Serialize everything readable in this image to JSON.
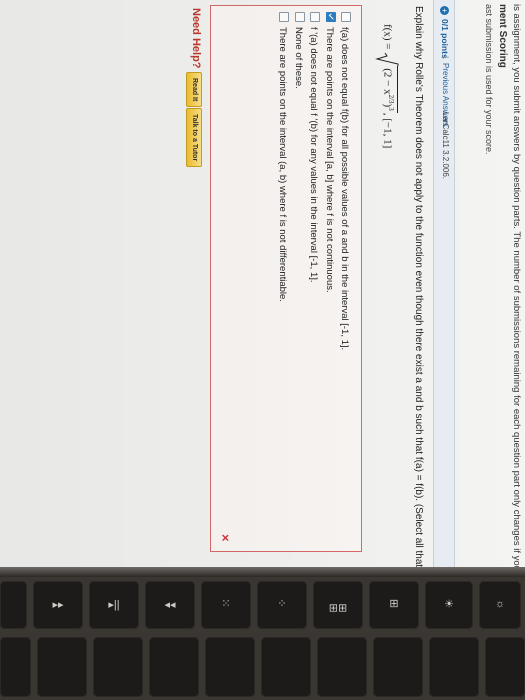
{
  "notice": "is assignment, you submit answers by question parts. The number of submissions remaining for each question part only changes if you submit or change the a",
  "heading": "ment Scoring",
  "last_submission": "ast submission is used for your score.",
  "question": {
    "number": "4.",
    "points_label": "0/1 points",
    "separator": "|",
    "previous_answers": "Previous Answers",
    "reference": "LarCalc11 3.2.006.",
    "prompt": "Explain why Rolle's Theorem does not apply to the function even though there exist a and b such that f(a) = f(b). (Select all that apply.)",
    "formula": {
      "lhs": "f(x) =",
      "inner": "(2 − x",
      "inner_exp": "2/3",
      "close": ")",
      "outer_exp": "3",
      "interval": ",  [−1, 1]"
    },
    "options": [
      {
        "text": "f(a) does not equal f(b) for all possible values of a and b in the interval [-1, 1].",
        "checked": false
      },
      {
        "text": "There are points on the interval [a, b] where f is not continuous.",
        "checked": true
      },
      {
        "text": "f '(a) does not equal f '(b) for any values in the interval [-1, 1].",
        "checked": false
      },
      {
        "text": "None of these.",
        "checked": false
      },
      {
        "text": "There are points on the interval (a, b) where f is not differentiable.",
        "checked": false
      }
    ],
    "result_mark": "×"
  },
  "help": {
    "label": "Need Help?",
    "read_it": "Read It",
    "talk_tutor": "Talk to a Tutor"
  },
  "keys": [
    "☼",
    "☀",
    "⊞",
    "⊞⊞",
    "⁘",
    "⁙",
    "◂◂",
    "▸||",
    "▸▸"
  ]
}
